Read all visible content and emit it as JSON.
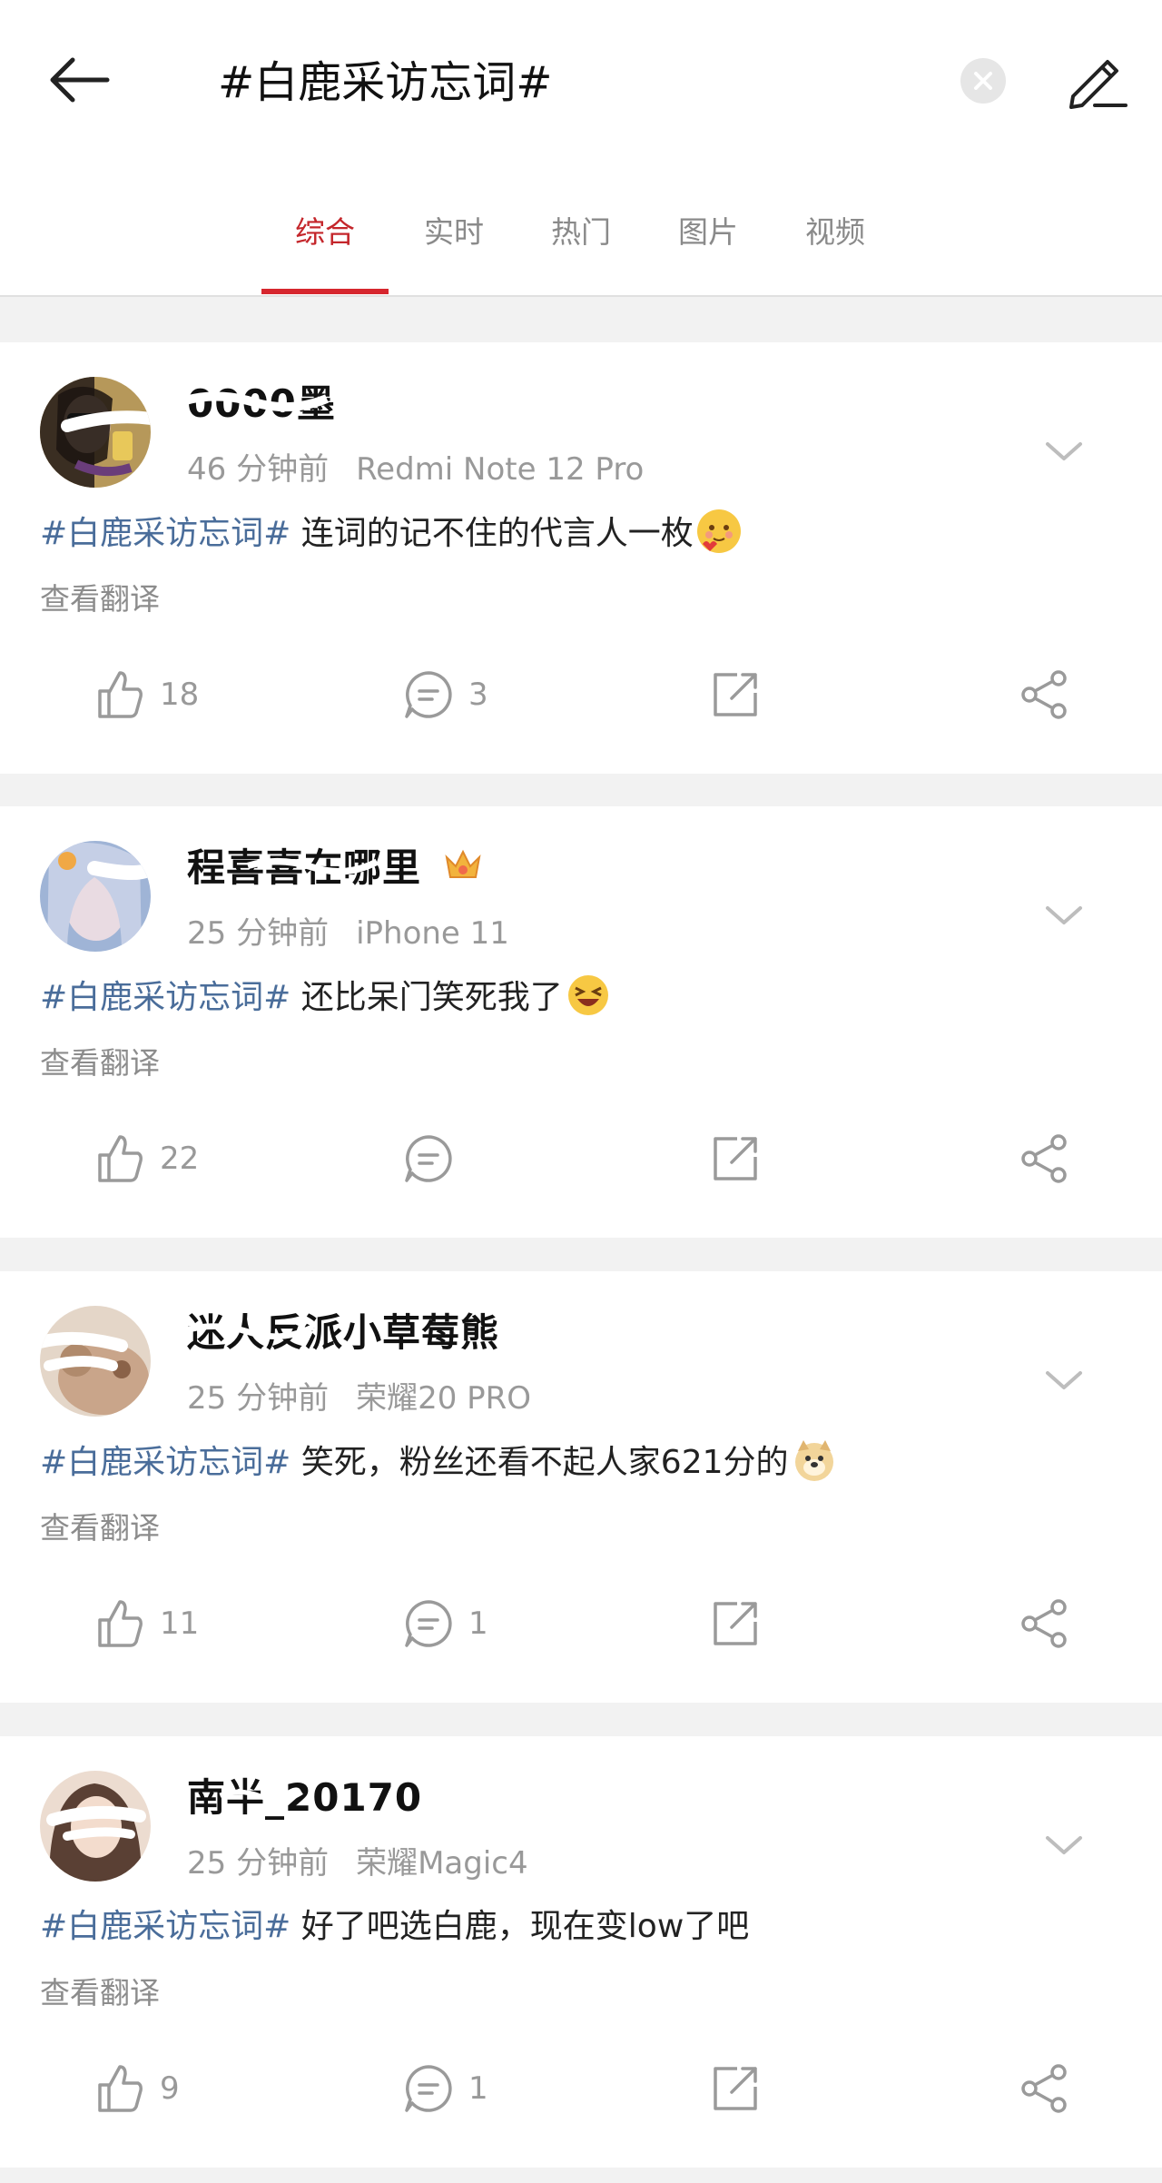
{
  "search": {
    "query": "#白鹿采访忘词#"
  },
  "tabs": [
    {
      "label": "综合",
      "active": true
    },
    {
      "label": "实时",
      "active": false
    },
    {
      "label": "热门",
      "active": false
    },
    {
      "label": "图片",
      "active": false
    },
    {
      "label": "视频",
      "active": false
    }
  ],
  "colors": {
    "accent": "#d6262e",
    "hashtag": "#4a6d9a",
    "meta": "#999999"
  },
  "posts": [
    {
      "username": "0000墨",
      "time": "46 分钟前",
      "device": "Redmi Note 12 Pro",
      "hashtag": "#白鹿采访忘词#",
      "text": " 连词的记不住的代言人一枚",
      "emoji": "blushing-face-with-heart-emoji",
      "translate": "查看翻译",
      "likes": "18",
      "comments": "3"
    },
    {
      "username": "程喜喜在哪里",
      "time": "25 分钟前",
      "device": "iPhone 11",
      "hashtag": "#白鹿采访忘词#",
      "text": " 还比呆门笑死我了",
      "emoji": "laughing-squint-emoji",
      "translate": "查看翻译",
      "likes": "22",
      "comments": ""
    },
    {
      "username": "迷人反派小草莓熊",
      "time": "25 分钟前",
      "device": "荣耀20 PRO",
      "hashtag": "#白鹿采访忘词#",
      "text": " 笑死，粉丝还看不起人家621分的",
      "emoji": "doge-emoji",
      "translate": "查看翻译",
      "likes": "11",
      "comments": "1"
    },
    {
      "username": "南半_20170",
      "time": "25 分钟前",
      "device": "荣耀Magic4",
      "hashtag": "#白鹿采访忘词#",
      "text": " 好了吧选白鹿，现在变low了吧",
      "emoji": "",
      "translate": "查看翻译",
      "likes": "9",
      "comments": "1"
    }
  ]
}
